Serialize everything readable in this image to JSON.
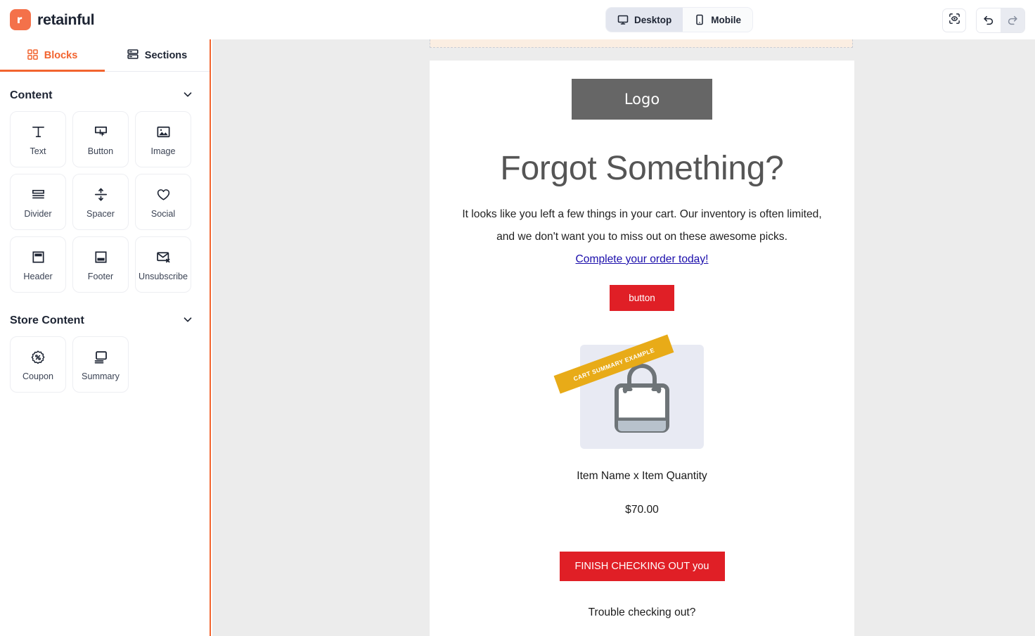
{
  "app": {
    "brand_name": "retainful",
    "brand_icon": "retainful-logo-icon",
    "brand_color": "#f4714a"
  },
  "topbar": {
    "device_toggle": [
      {
        "label": "Desktop",
        "icon": "desktop-monitor-icon",
        "active": true
      },
      {
        "label": "Mobile",
        "icon": "mobile-phone-icon",
        "active": false
      }
    ],
    "actions": [
      {
        "name": "preview-button",
        "icon": "preview-eye-scan-icon"
      },
      {
        "name": "undo-button",
        "icon": "undo-arrow-icon"
      },
      {
        "name": "redo-button",
        "icon": "redo-arrow-icon"
      }
    ]
  },
  "sidebar": {
    "tabs": [
      {
        "label": "Blocks",
        "icon": "grid-blocks-icon",
        "active": true
      },
      {
        "label": "Sections",
        "icon": "stacked-rows-icon",
        "active": false
      }
    ],
    "groups": [
      {
        "title": "Content",
        "collapse_icon": "chevron-down-icon",
        "tiles": [
          {
            "label": "Text",
            "icon": "text-t-icon"
          },
          {
            "label": "Button",
            "icon": "button-cursor-icon"
          },
          {
            "label": "Image",
            "icon": "image-picture-icon"
          },
          {
            "label": "Divider",
            "icon": "divider-lines-icon"
          },
          {
            "label": "Spacer",
            "icon": "spacer-arrows-icon"
          },
          {
            "label": "Social",
            "icon": "heart-social-icon"
          },
          {
            "label": "Header",
            "icon": "header-layout-icon"
          },
          {
            "label": "Footer",
            "icon": "footer-layout-icon"
          },
          {
            "label": "Unsubscribe",
            "icon": "envelope-x-icon"
          }
        ]
      },
      {
        "title": "Store Content",
        "collapse_icon": "chevron-down-icon",
        "tiles": [
          {
            "label": "Coupon",
            "icon": "coupon-percent-badge-icon"
          },
          {
            "label": "Summary",
            "icon": "summary-monitor-icon"
          }
        ]
      }
    ]
  },
  "email": {
    "logo_placeholder": "Logo",
    "headline": "Forgot Something?",
    "body_line_1": "It looks like you left a few things in your cart. Our inventory is often limited,",
    "body_line_2": "and we don't want you to miss out on these awesome picks.",
    "link_text": "Complete your order today!",
    "small_button_label": "button",
    "ribbon_label": "CART SUMMARY EXAMPLE",
    "product_image_icon": "shopping-bag-icon",
    "item_name": "Item Name x Item Quantity",
    "item_price": "$70.00",
    "checkout_button_label": "FINISH CHECKING OUT you",
    "trouble_text": "Trouble checking out?",
    "colors": {
      "cta": "#e01f26",
      "link": "#1a0dab",
      "logo_bg": "#666666",
      "ribbon": "#e8ab18",
      "product_bg": "#e8eaf3"
    }
  }
}
